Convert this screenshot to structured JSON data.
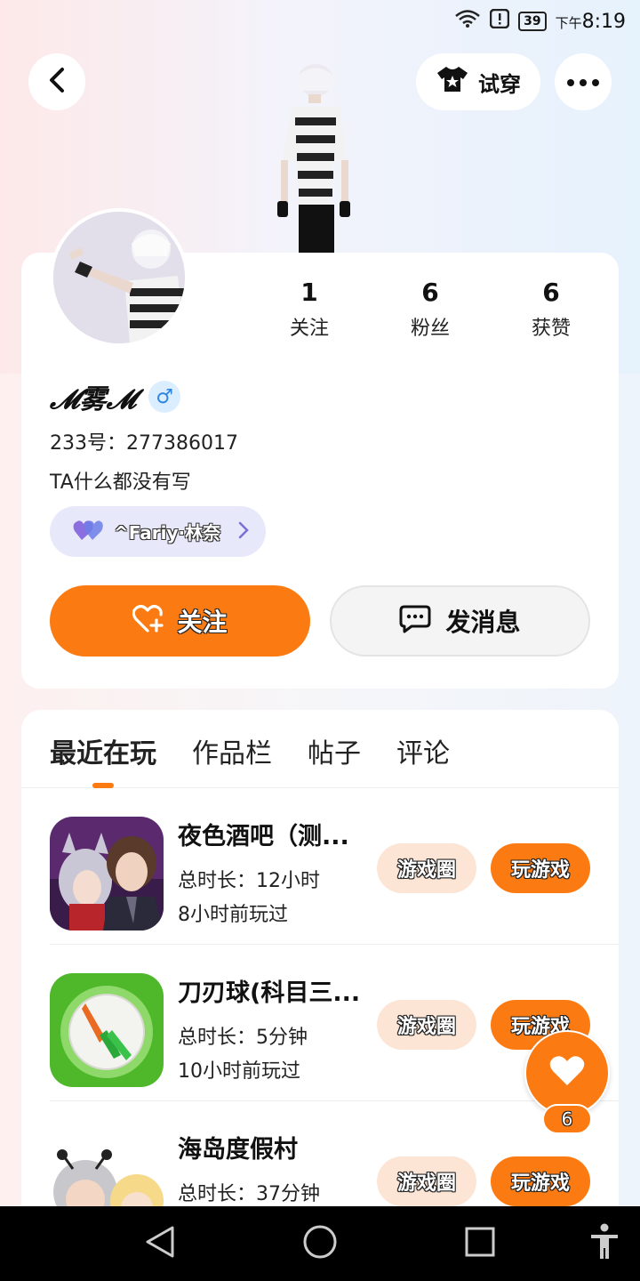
{
  "status_bar": {
    "battery": "39",
    "time_prefix": "下午",
    "time": "8:19"
  },
  "header": {
    "try_on_label": "试穿"
  },
  "profile": {
    "stats": [
      {
        "value": "1",
        "label": "关注"
      },
      {
        "value": "6",
        "label": "粉丝"
      },
      {
        "value": "6",
        "label": "获赞"
      }
    ],
    "username": "𝓜雾𝓜",
    "gender_symbol": "♂",
    "id_line": "233号：277386017",
    "bio": "TA什么都没有写",
    "cp_name": "^Fariy·林奈",
    "follow_label": "关注",
    "message_label": "发消息"
  },
  "tabs": [
    {
      "label": "最近在玩"
    },
    {
      "label": "作品栏"
    },
    {
      "label": "帖子"
    },
    {
      "label": "评论"
    }
  ],
  "games": [
    {
      "title": "夜色酒吧（测...",
      "duration": "总时长：12小时",
      "last_played": "8小时前玩过",
      "circle_label": "游戏圈",
      "play_label": "玩游戏"
    },
    {
      "title": "刀刃球(科目三...",
      "duration": "总时长：5分钟",
      "last_played": "10小时前玩过",
      "circle_label": "游戏圈",
      "play_label": "玩游戏"
    },
    {
      "title": "海岛度假村",
      "duration": "总时长：37分钟",
      "last_played": "",
      "circle_label": "游戏圈",
      "play_label": "玩游戏"
    }
  ],
  "fab": {
    "like_count": "6"
  },
  "colors": {
    "accent": "#fb7b12",
    "circle_bg": "#fde5d6",
    "cp_pill_bg": "#e8e8fb",
    "gender_bg": "#dbeeff"
  }
}
